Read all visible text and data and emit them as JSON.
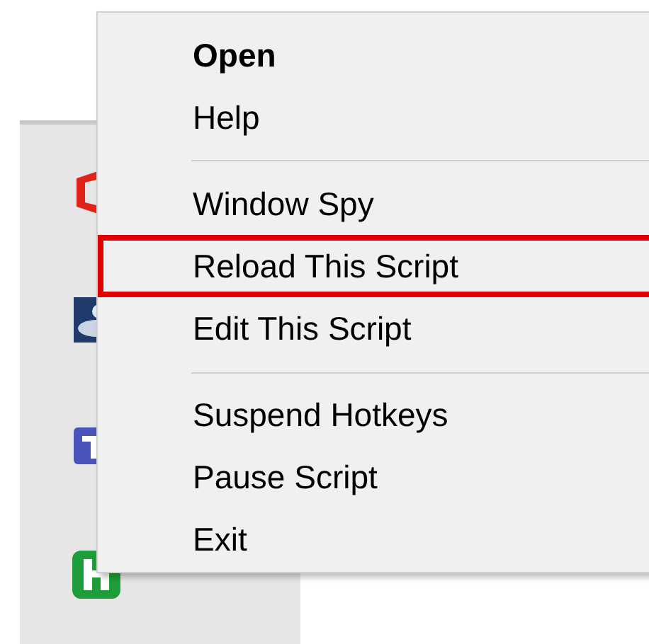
{
  "tray_icons": [
    {
      "kind": "office"
    },
    {
      "kind": "photo"
    },
    {
      "kind": "teams"
    },
    {
      "kind": "letter_h"
    }
  ],
  "context_menu": {
    "sections": [
      [
        {
          "label": "Open",
          "bold": true,
          "highlighted": false
        },
        {
          "label": "Help",
          "bold": false,
          "highlighted": false
        }
      ],
      [
        {
          "label": "Window Spy",
          "bold": false,
          "highlighted": false
        },
        {
          "label": "Reload This Script",
          "bold": false,
          "highlighted": true
        },
        {
          "label": "Edit This Script",
          "bold": false,
          "highlighted": false
        }
      ],
      [
        {
          "label": "Suspend Hotkeys",
          "bold": false,
          "highlighted": false
        },
        {
          "label": "Pause Script",
          "bold": false,
          "highlighted": false
        },
        {
          "label": "Exit",
          "bold": false,
          "highlighted": false
        }
      ]
    ]
  }
}
